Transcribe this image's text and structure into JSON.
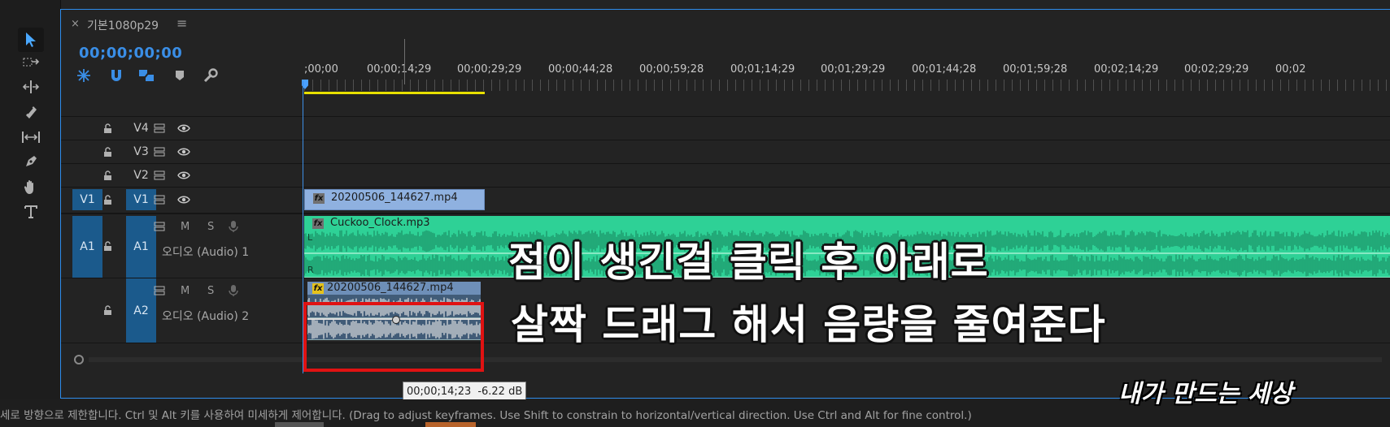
{
  "sequence_tab": {
    "close": "×",
    "title": "기본1080p29",
    "menu": "≡"
  },
  "timecode": "00;00;00;00",
  "ruler": {
    "labels": [
      ";00;00",
      "00;00;14;29",
      "00;00;29;29",
      "00;00;44;28",
      "00;00;59;28",
      "00;01;14;29",
      "00;01;29;29",
      "00;01;44;28",
      "00;01;59;28",
      "00;02;14;29",
      "00;02;29;29",
      "00;02"
    ]
  },
  "tracks": {
    "v4": {
      "label": "V4"
    },
    "v3": {
      "label": "V3"
    },
    "v2": {
      "label": "V2"
    },
    "v1": {
      "source": "V1",
      "label": "V1"
    },
    "a1": {
      "source": "A1",
      "label": "A1",
      "name": "오디오 (Audio) 1",
      "m": "M",
      "s": "S"
    },
    "a2": {
      "label": "A2",
      "name": "오디오 (Audio) 2",
      "m": "M",
      "s": "S"
    }
  },
  "clips": {
    "video": {
      "name": "20200506_144627.mp4",
      "fx": "fx"
    },
    "audio1": {
      "name": "Cuckoo_Clock.mp3",
      "fx": "fx",
      "left": "L",
      "right": "R"
    },
    "audio2": {
      "name": "20200506_144627.mp4",
      "fx": "fx"
    }
  },
  "tooltip": {
    "time": "00;00;14;23",
    "level": "-6.22 dB"
  },
  "status": "세로 방향으로 제한합니다. Ctrl 및 Alt 키를 사용하여 미세하게 제어합니다. (Drag to adjust keyframes. Use Shift to constrain to horizontal/vertical direction. Use Ctrl and Alt for fine control.)",
  "overlay": {
    "line1": "점이 생긴걸 클릭 후 아래로",
    "line2": "살짝 드래그 해서 음량을 줄여준다",
    "watermark": "내가 만드는 세상"
  },
  "colors": {
    "accent": "#2d8ceb",
    "audio_clip": "#2ed196",
    "video_clip": "#8fb1e0",
    "highlight": "#e01212",
    "workarea": "#e8e000"
  }
}
